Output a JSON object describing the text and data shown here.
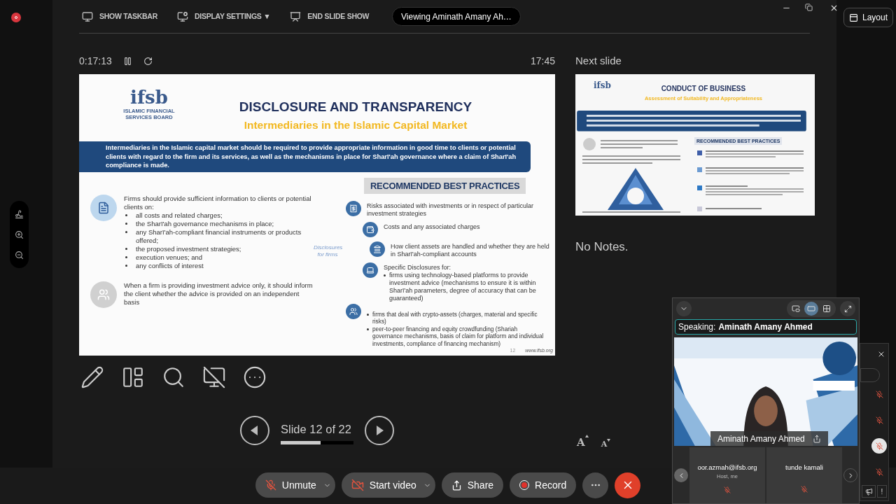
{
  "toolbar": [
    {
      "label": "SHOW TASKBAR",
      "kind": "taskbar"
    },
    {
      "label": "DISPLAY SETTINGS ▼",
      "kind": "display"
    },
    {
      "label": "END SLIDE SHOW",
      "kind": "end"
    }
  ],
  "viewing_banner": "Viewing Aminath Amany Ah…",
  "layout_button": "Layout",
  "presenter": {
    "elapsed": "0:17:13",
    "clock": "17:45",
    "next_slide_label": "Next slide",
    "notes": "No Notes.",
    "slide_counter": "Slide 12 of 22",
    "progress": {
      "level": 0.55
    },
    "font_buttons": [
      {
        "label": "A",
        "kind": "increase"
      },
      {
        "label": "A",
        "kind": "decrease"
      }
    ]
  },
  "slide": {
    "logo": "ifsb",
    "logo_caption": "ISLAMIC FINANCIAL SERVICES BOARD",
    "title": "DISCLOSURE AND TRANSPARENCY",
    "subtitle": "Intermediaries in the Islamic Capital Market",
    "banner": "Intermediaries in the Islamic capital market should be required to provide appropriate information in good time to clients or potential clients with regard to the firm and its services, as well as the mechanisms in place for Sharī'ah governance where a claim of Sharī'ah compliance is made.",
    "left_blocks": [
      {
        "kind": "document",
        "text": "Firms should provide sufficient information to clients or potential clients on:",
        "bullets": [
          "all costs and related charges;",
          "the Sharī'ah governance mechanisms in place;",
          "any Sharī'ah-compliant financial instruments or products offered;",
          "the proposed investment strategies;",
          "execution venues; and",
          "any conflicts of interest"
        ]
      },
      {
        "kind": "advisor",
        "text": "When a firm is providing investment advice only, it should inform the client whether the advice is provided on an independent basis"
      }
    ],
    "practices_heading": "RECOMMENDED BEST PRACTICES",
    "timeline_label": "Disclosures for firms",
    "timeline": [
      {
        "text": "Risks associated with investments or in respect of particular investment strategies"
      },
      {
        "text": "Costs and any associated charges"
      },
      {
        "text": "How client assets are handled and whether they are held in Sharī'ah-compliant accounts"
      },
      {
        "text": "Specific Disclosures for:",
        "bullets": [
          "firms using technology-based platforms to provide investment advice (mechanisms to ensure it is within Sharī'ah parameters, degree of accuracy that can be guaranteed)"
        ]
      }
    ],
    "extra_bullets": [
      "firms that deal with crypto-assets (charges, material and specific risks)",
      "peer-to-peer financing and equity crowdfunding (Shariah governance mechanisms, basis of claim for platform and individual investments, compliance of financing mechanism)"
    ],
    "page_number": "12",
    "website": "www.ifsb.org"
  },
  "next_slide": {
    "logo": "ifsb",
    "title": "CONDUCT OF BUSINESS",
    "subtitle": "Assessment of Suitability and Appropriateness",
    "practices_heading": "RECOMMENDED BEST PRACTICES"
  },
  "video_panel": {
    "view_modes": [
      {
        "kind": "pip",
        "selected": false
      },
      {
        "kind": "speaker",
        "selected": true
      },
      {
        "kind": "grid",
        "selected": false
      }
    ],
    "speaking_label": "Speaking:",
    "speaker": "Aminath Amany Ahmed",
    "video_name": "Aminath Amany Ahmed",
    "tiles": [
      {
        "name": "oor.azmah@ifsb.org",
        "role": "Host, me",
        "muted": true
      },
      {
        "name": "tunde kamali",
        "muted": true
      }
    ]
  },
  "participants_panel": {
    "rows": [
      {
        "muted": true,
        "selected": false
      },
      {
        "muted": true,
        "selected": false
      },
      {
        "muted": true,
        "selected": true
      },
      {
        "muted": true,
        "selected": false
      }
    ],
    "alert_button": "!"
  },
  "controls": [
    {
      "kind": "mute",
      "label": "Unmute",
      "has_menu": true
    },
    {
      "kind": "video",
      "label": "Start video",
      "has_menu": true
    },
    {
      "kind": "share",
      "label": "Share",
      "has_menu": false
    },
    {
      "kind": "record",
      "label": "Record",
      "has_menu": false
    },
    {
      "kind": "more"
    },
    {
      "kind": "leave"
    }
  ]
}
